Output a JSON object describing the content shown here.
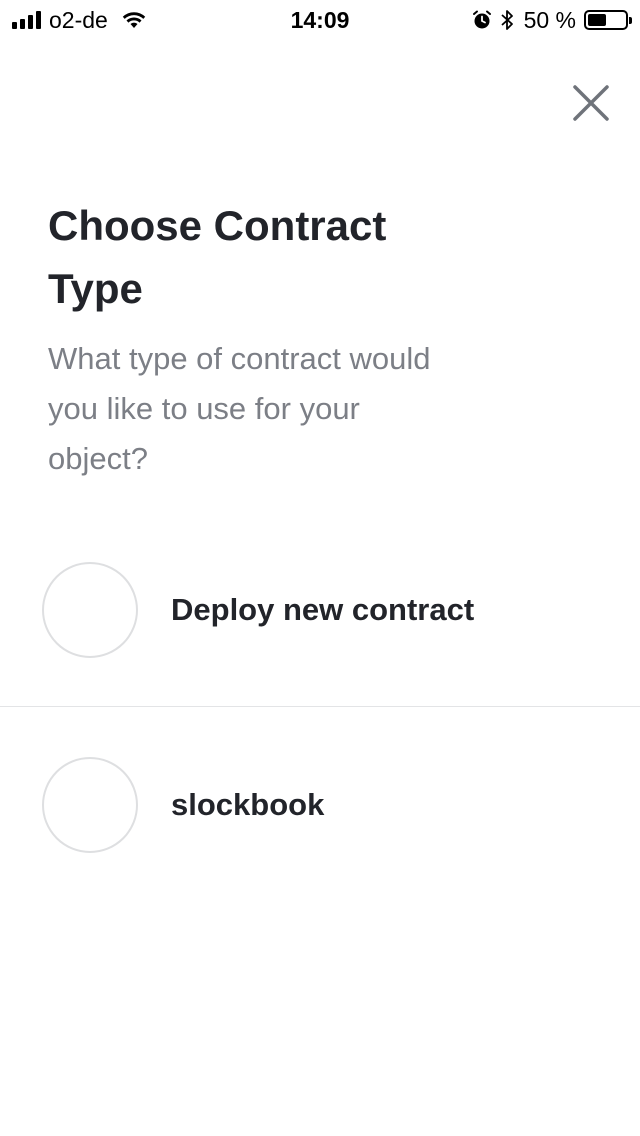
{
  "status_bar": {
    "carrier": "o2-de",
    "time": "14:09",
    "battery_percent_label": "50 %",
    "battery_level": 0.5,
    "icons": [
      "signal-icon",
      "wifi-icon",
      "alarm-icon",
      "bluetooth-icon",
      "battery-icon"
    ]
  },
  "header": {
    "close_icon": "close-icon"
  },
  "main": {
    "title": "Choose Contract Type",
    "subtitle": "What type of contract would you like to use for your object?",
    "options": [
      {
        "label": "Deploy new contract",
        "selected": false
      },
      {
        "label": "slockbook",
        "selected": false
      }
    ]
  },
  "colors": {
    "text_primary": "#22242a",
    "text_secondary": "#7c7f86",
    "divider": "#e3e4e6",
    "radio_border": "#dedfe1",
    "close_icon": "#6f737a"
  }
}
